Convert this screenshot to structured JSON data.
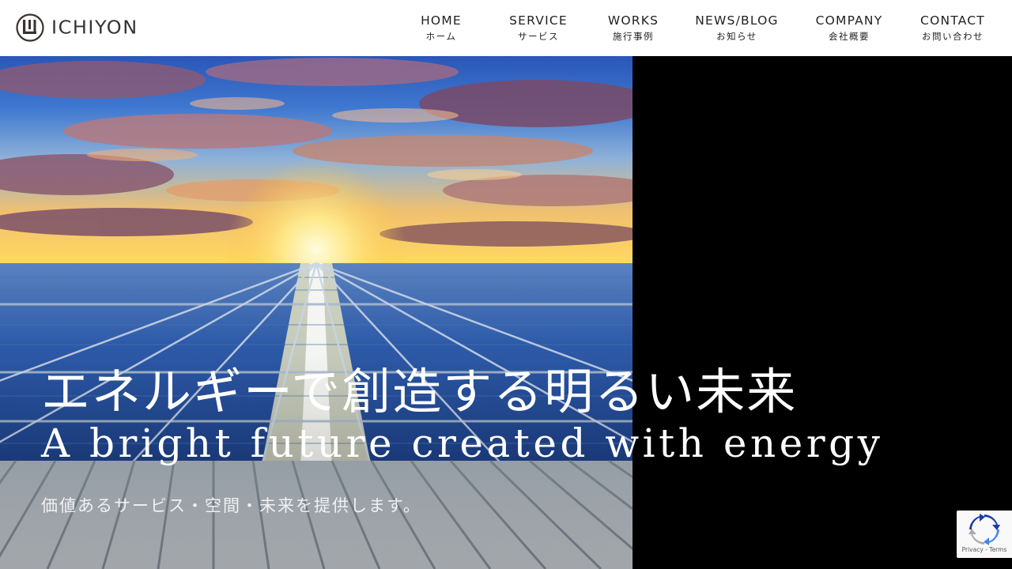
{
  "brand": {
    "name": "ICHIYON",
    "logo_icon": "ichiyon-circle-logo-icon"
  },
  "nav": {
    "items": [
      {
        "en": "HOME",
        "ja": "ホーム"
      },
      {
        "en": "SERVICE",
        "ja": "サービス"
      },
      {
        "en": "WORKS",
        "ja": "施行事例"
      },
      {
        "en": "NEWS/BLOG",
        "ja": "お知らせ"
      },
      {
        "en": "COMPANY",
        "ja": "会社概要"
      },
      {
        "en": "CONTACT",
        "ja": "お問い合わせ"
      }
    ]
  },
  "hero": {
    "title_ja": "エネルギーで創造する明るい未来",
    "title_en": "A bright future created with energy",
    "subtitle": "価値あるサービス・空間・未来を提供します。",
    "image": "sunset-over-solar-panels"
  },
  "recaptcha": {
    "privacy": "Privacy",
    "separator": " - ",
    "terms": "Terms",
    "icon": "recaptcha-logo-icon"
  }
}
